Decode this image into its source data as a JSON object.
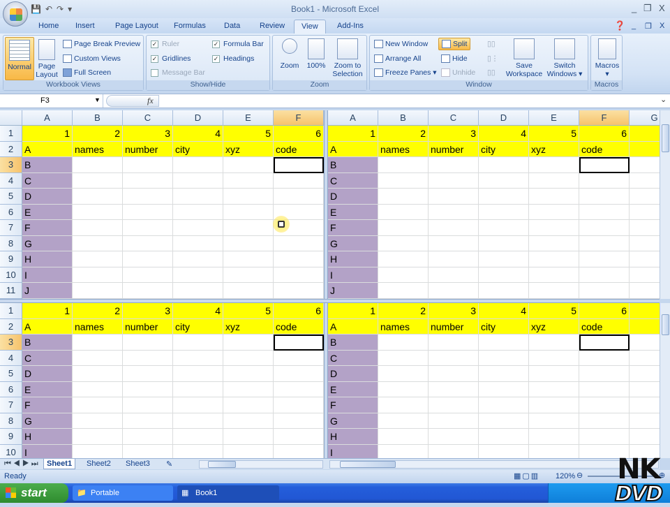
{
  "window": {
    "title": "Book1 - Microsoft Excel",
    "controls": [
      "_",
      "❐",
      "X"
    ]
  },
  "ribbon_tabs": [
    "Home",
    "Insert",
    "Page Layout",
    "Formulas",
    "Data",
    "Review",
    "View",
    "Add-Ins"
  ],
  "active_tab": "View",
  "ribbon": {
    "workbook_views": {
      "label": "Workbook Views",
      "normal": "Normal",
      "page_layout": "Page Layout",
      "page_break_preview": "Page Break Preview",
      "custom_views": "Custom Views",
      "full_screen": "Full Screen"
    },
    "show_hide": {
      "label": "Show/Hide",
      "ruler": "Ruler",
      "gridlines": "Gridlines",
      "message_bar": "Message Bar",
      "formula_bar": "Formula Bar",
      "headings": "Headings",
      "ruler_checked": true,
      "gridlines_checked": true,
      "message_bar_checked": false,
      "formula_bar_checked": true,
      "headings_checked": true
    },
    "zoom": {
      "label": "Zoom",
      "zoom": "Zoom",
      "hundred": "100%",
      "zoom_to_selection": "Zoom to Selection"
    },
    "window": {
      "label": "Window",
      "new_window": "New Window",
      "arrange_all": "Arrange All",
      "freeze_panes": "Freeze Panes",
      "split": "Split",
      "hide": "Hide",
      "unhide": "Unhide",
      "save_workspace": "Save Workspace",
      "switch_windows": "Switch Windows"
    },
    "macros": {
      "label": "Macros",
      "macros": "Macros"
    }
  },
  "formula_bar": {
    "name_box": "F3",
    "fx": "fx",
    "value": ""
  },
  "sheet": {
    "columns_left": [
      "A",
      "B",
      "C",
      "D",
      "E",
      "F"
    ],
    "columns_right": [
      "A",
      "B",
      "C",
      "D",
      "E",
      "F",
      "G"
    ],
    "selected_cell": "F3",
    "rows": [
      [
        "1",
        "2",
        "3",
        "4",
        "5",
        "6",
        ""
      ],
      [
        "A",
        "names",
        "number",
        "city",
        "xyz",
        "code",
        ""
      ],
      [
        "B",
        "",
        "",
        "",
        "",
        "",
        ""
      ],
      [
        "C",
        "",
        "",
        "",
        "",
        "",
        ""
      ],
      [
        "D",
        "",
        "",
        "",
        "",
        "",
        ""
      ],
      [
        "E",
        "",
        "",
        "",
        "",
        "",
        ""
      ],
      [
        "F",
        "",
        "",
        "",
        "",
        "",
        ""
      ],
      [
        "G",
        "",
        "",
        "",
        "",
        "",
        ""
      ],
      [
        "H",
        "",
        "",
        "",
        "",
        "",
        ""
      ],
      [
        "I",
        "",
        "",
        "",
        "",
        "",
        ""
      ],
      [
        "J",
        "",
        "",
        "",
        "",
        "",
        ""
      ]
    ],
    "colors": {
      "header_fill": "#ffff00",
      "column_a_fill": "#b3a2c7"
    }
  },
  "sheet_tabs": [
    "Sheet1",
    "Sheet2",
    "Sheet3"
  ],
  "active_sheet": "Sheet1",
  "status": {
    "text": "Ready",
    "zoom": "120%"
  },
  "taskbar": {
    "start": "start",
    "items": [
      "Portable",
      "Book1"
    ]
  },
  "watermark": "NK DVD"
}
